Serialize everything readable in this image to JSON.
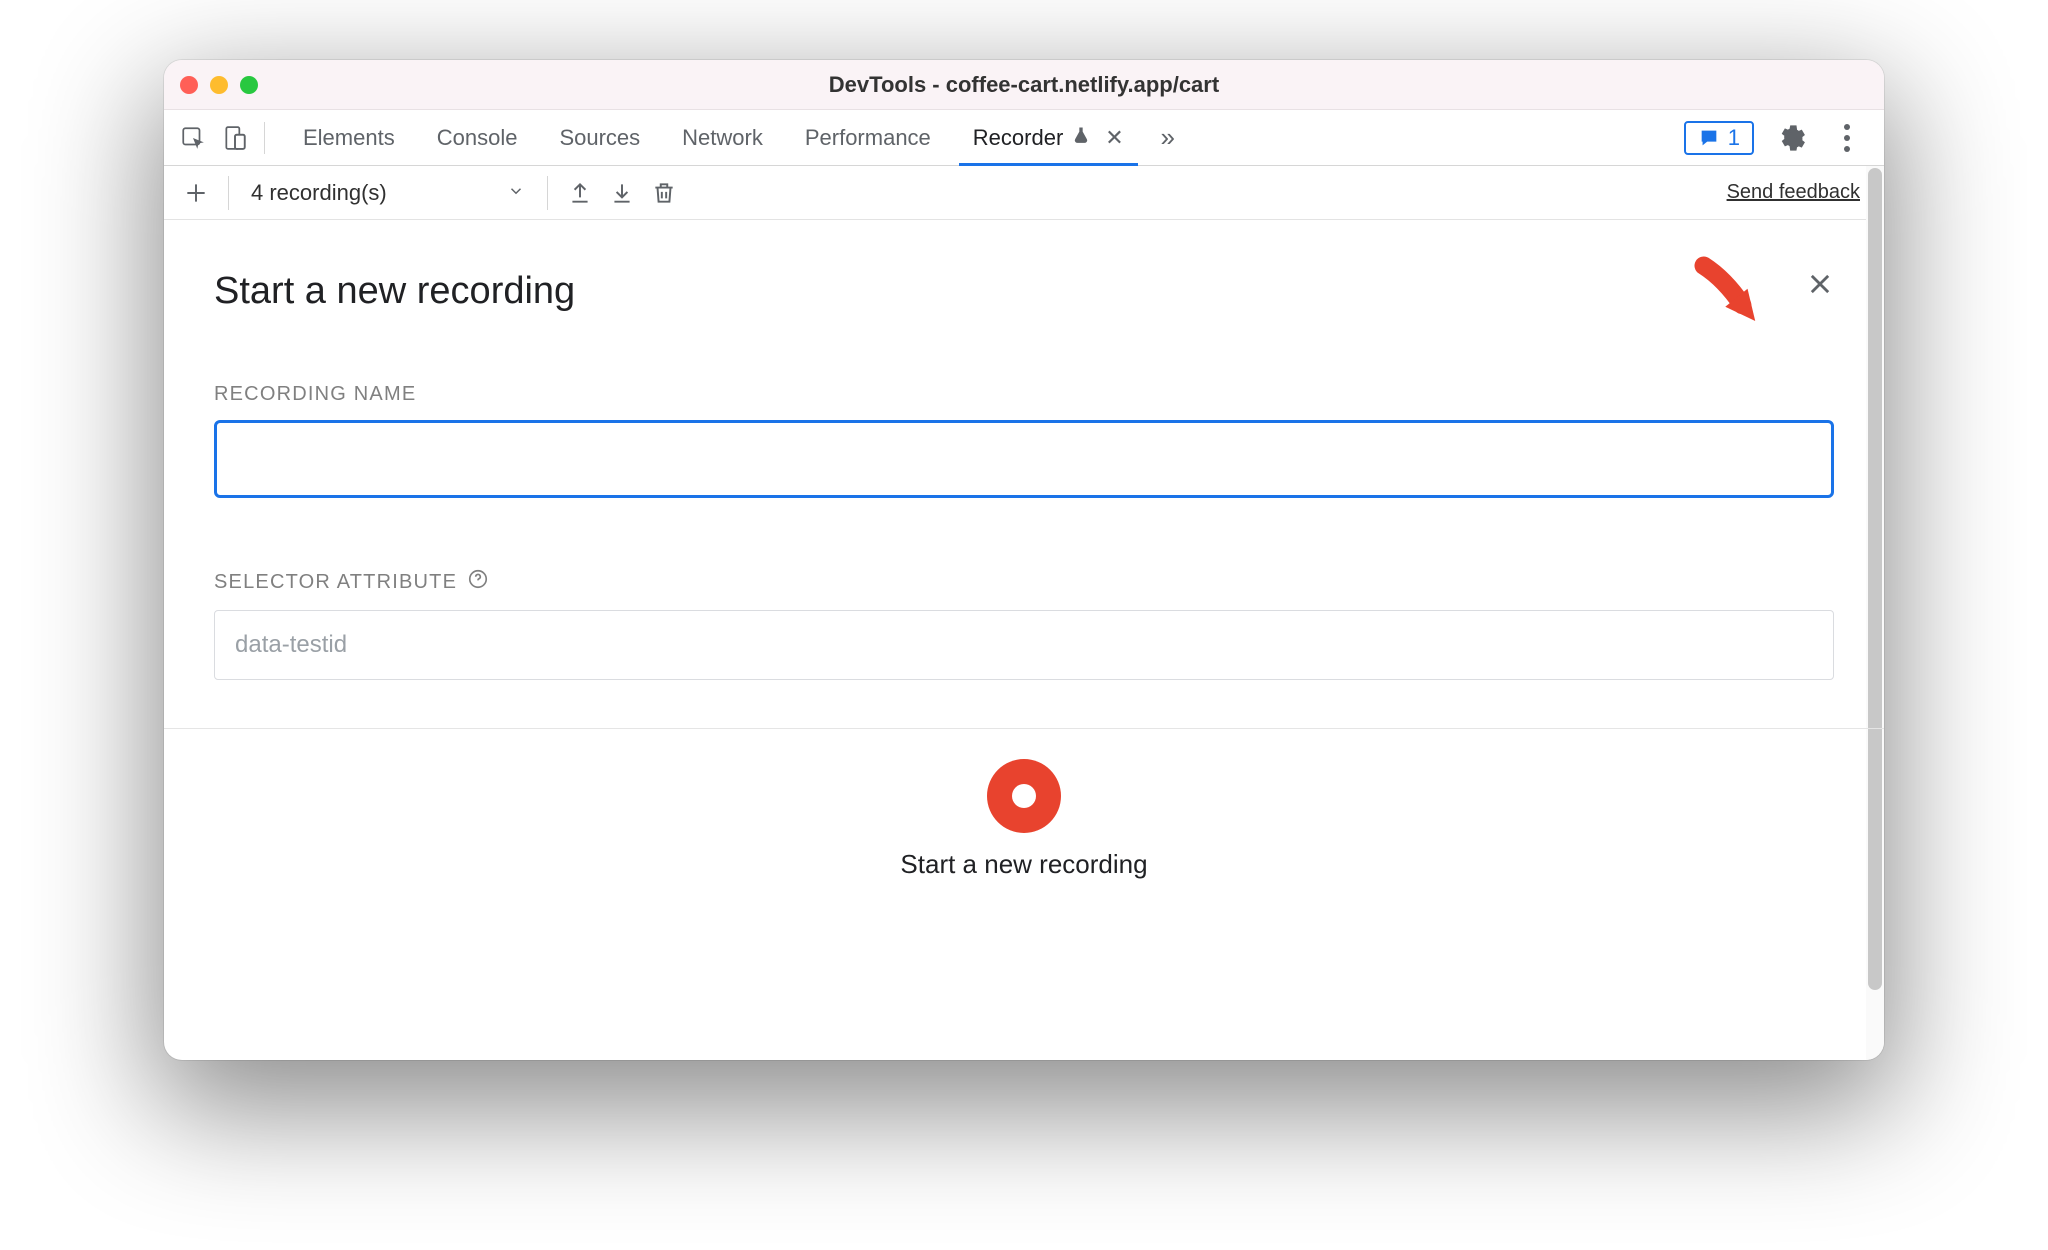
{
  "window": {
    "title": "DevTools - coffee-cart.netlify.app/cart"
  },
  "tabs": {
    "items": [
      {
        "label": "Elements"
      },
      {
        "label": "Console"
      },
      {
        "label": "Sources"
      },
      {
        "label": "Network"
      },
      {
        "label": "Performance"
      },
      {
        "label": "Recorder"
      }
    ],
    "issues_count": "1"
  },
  "toolbar": {
    "dropdown_label": "4 recording(s)",
    "feedback_label": "Send feedback"
  },
  "panel": {
    "title": "Start a new recording",
    "recording_name_label": "RECORDING NAME",
    "recording_name_value": "",
    "selector_attr_label": "SELECTOR ATTRIBUTE",
    "selector_attr_placeholder": "data-testid",
    "selector_attr_value": "",
    "record_button_label": "Start a new recording"
  },
  "colors": {
    "accent": "#1a73e8",
    "record": "#e8432e"
  }
}
